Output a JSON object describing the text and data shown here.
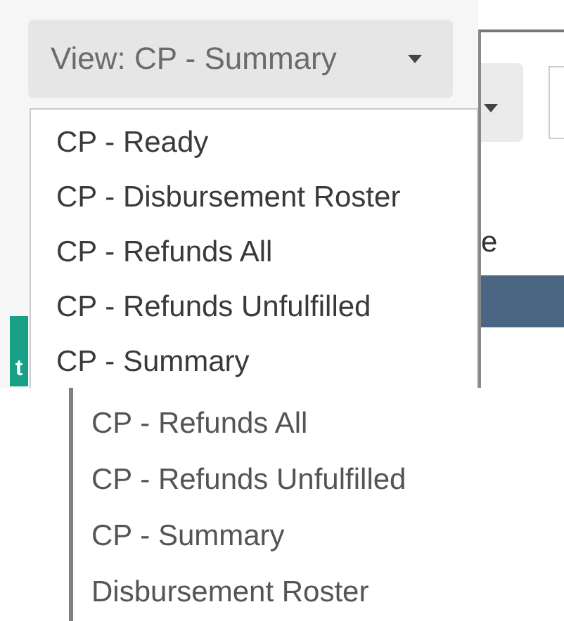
{
  "view_button": {
    "label": "View: CP - Summary"
  },
  "view_menu": {
    "items": [
      {
        "label": "CP - Ready"
      },
      {
        "label": "CP - Disbursement Roster"
      },
      {
        "label": "CP - Refunds All"
      },
      {
        "label": "CP - Refunds Unfulfilled"
      },
      {
        "label": "CP - Summary"
      }
    ]
  },
  "background": {
    "partial_text": "e",
    "badge_text": "t"
  },
  "view_list": {
    "items": [
      {
        "label": "CP - Refunds All"
      },
      {
        "label": "CP - Refunds Unfulfilled"
      },
      {
        "label": "CP - Summary"
      },
      {
        "label": "Disbursement Roster"
      }
    ]
  }
}
